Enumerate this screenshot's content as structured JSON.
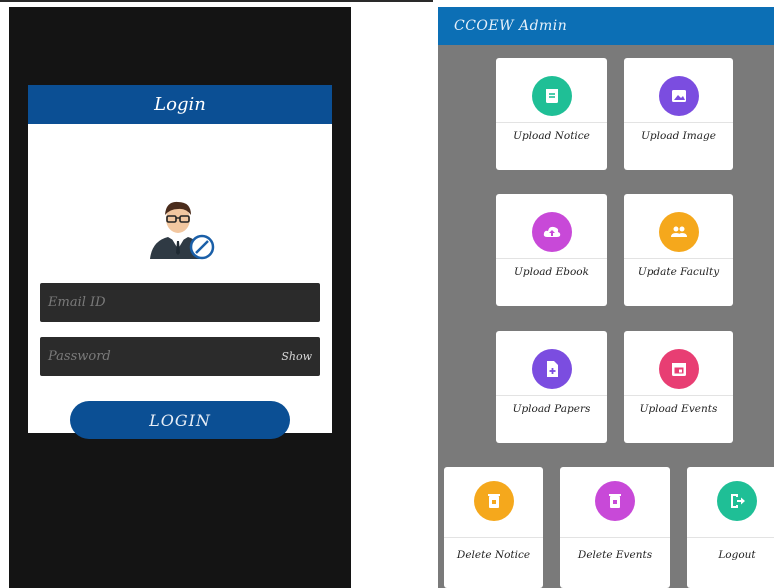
{
  "login": {
    "title": "Login",
    "email_placeholder": "Email ID",
    "password_placeholder": "Password",
    "show_label": "Show",
    "button_label": "LOGIN"
  },
  "admin": {
    "title": "CCOEW Admin",
    "tiles": [
      {
        "label": "Upload Notice",
        "color": "#1fbf96",
        "icon": "notice-icon"
      },
      {
        "label": "Upload Image",
        "color": "#7b4de0",
        "icon": "image-icon"
      },
      {
        "label": "Upload Ebook",
        "color": "#c849d8",
        "icon": "cloud-upload-icon"
      },
      {
        "label": "Update Faculty",
        "color": "#f5a81c",
        "icon": "people-icon"
      },
      {
        "label": "Upload Papers",
        "color": "#7b4de0",
        "icon": "file-add-icon"
      },
      {
        "label": "Upload Events",
        "color": "#e83e73",
        "icon": "calendar-icon"
      },
      {
        "label": "Delete Notice",
        "color": "#f5a81c",
        "icon": "trash-icon"
      },
      {
        "label": "Delete Events",
        "color": "#c849d8",
        "icon": "trash-icon"
      },
      {
        "label": "Logout",
        "color": "#1fbf96",
        "icon": "logout-icon"
      }
    ]
  }
}
